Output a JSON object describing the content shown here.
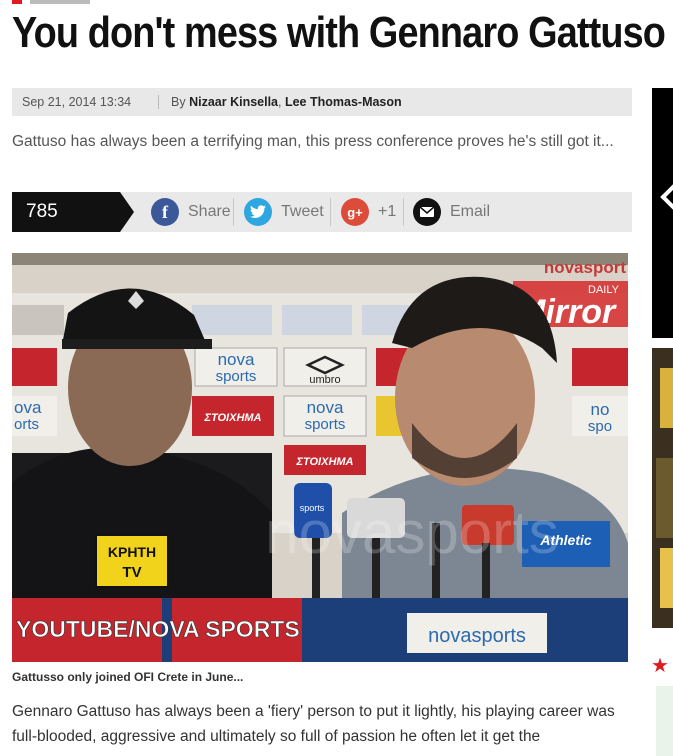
{
  "article": {
    "title": "You don't mess with Gennaro Gattuso",
    "date": "Sep 21, 2014 13:34",
    "by_prefix": "By",
    "author1": "Nizaar Kinsella",
    "author2": "Lee Thomas-Mason",
    "standfirst": "Gattuso has always been a terrifying man, this press conference proves he's still got it...",
    "caption": "Gattusso only joined OFI Crete in June...",
    "body": "Gennaro Gattuso has always been a 'fiery' person to put it lightly, his playing career was full-blooded, aggressive and ultimately so full of passion he often let it get the"
  },
  "share": {
    "count_label": "785 Shares",
    "facebook": "Share",
    "twitter": "Tweet",
    "gplus": "+1",
    "email": "Email"
  },
  "photo": {
    "watermark_top": "novasport",
    "daily_mirror_small": "DAILY",
    "daily_mirror_big": "Mirror",
    "credit": "YOUTUBE/NOVA SPORTS",
    "tv_logo_line1": "ΚΡΗΤΗ",
    "tv_logo_line2": "TV",
    "board_nova": "nova",
    "board_sports": "sports",
    "board_umbro": "umbro",
    "board_stoixima": "ΣΤΟΙΧΗΜΑ",
    "athletic": "Athletic",
    "novasports_bottom": "novasports",
    "big_watermark": "novasports"
  },
  "colors": {
    "facebook": "#3b5998",
    "twitter": "#2ea7e0",
    "gplus": "#dd4b39",
    "email": "#111111",
    "accent_red": "#e01a22"
  }
}
